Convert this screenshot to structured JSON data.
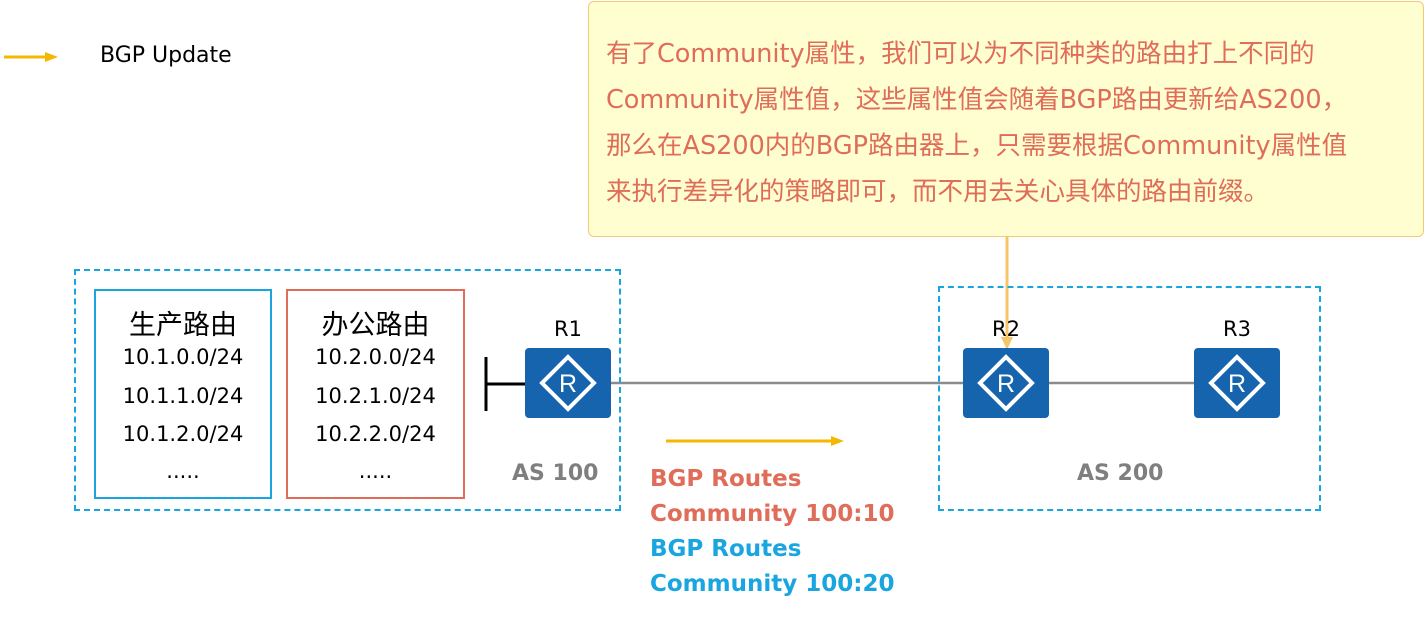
{
  "legend": {
    "label": "BGP Update",
    "arrow_color": "#f5b800"
  },
  "callout": {
    "lines": [
      "有了Community属性，我们可以为不同种类的路由打上不同的",
      "Community属性值，这些属性值会随着BGP路由更新给AS200，",
      "那么在AS200内的BGP路由器上，只需要根据Community属性值",
      "来执行差异化的策略即可，而不用去关心具体的路由前缀。"
    ],
    "text_color": "#e06c5a",
    "background": "#fefed0"
  },
  "as100": {
    "label": "AS 100",
    "route_groups": [
      {
        "title": "生产路由",
        "entries": [
          "10.1.0.0/24",
          "10.1.1.0/24",
          "10.1.2.0/24",
          "....."
        ],
        "border_color": "#18a5e0"
      },
      {
        "title": "办公路由",
        "entries": [
          "10.2.0.0/24",
          "10.2.1.0/24",
          "10.2.2.0/24",
          "....."
        ],
        "border_color": "#e06c5a"
      }
    ],
    "router": {
      "label": "R1",
      "icon": "router-icon"
    }
  },
  "as200": {
    "label": "AS 200",
    "routers": [
      {
        "label": "R2",
        "icon": "router-icon"
      },
      {
        "label": "R3",
        "icon": "router-icon"
      }
    ]
  },
  "updates": [
    {
      "label": "BGP Routes",
      "community": "Community 100:10",
      "color": "#e06c5a"
    },
    {
      "label": "BGP Routes",
      "community": "Community 100:20",
      "color": "#18a5e0"
    }
  ],
  "colors": {
    "router": "#1564ad",
    "as_border": "#18a5e0",
    "link": "#8c8c8c"
  }
}
